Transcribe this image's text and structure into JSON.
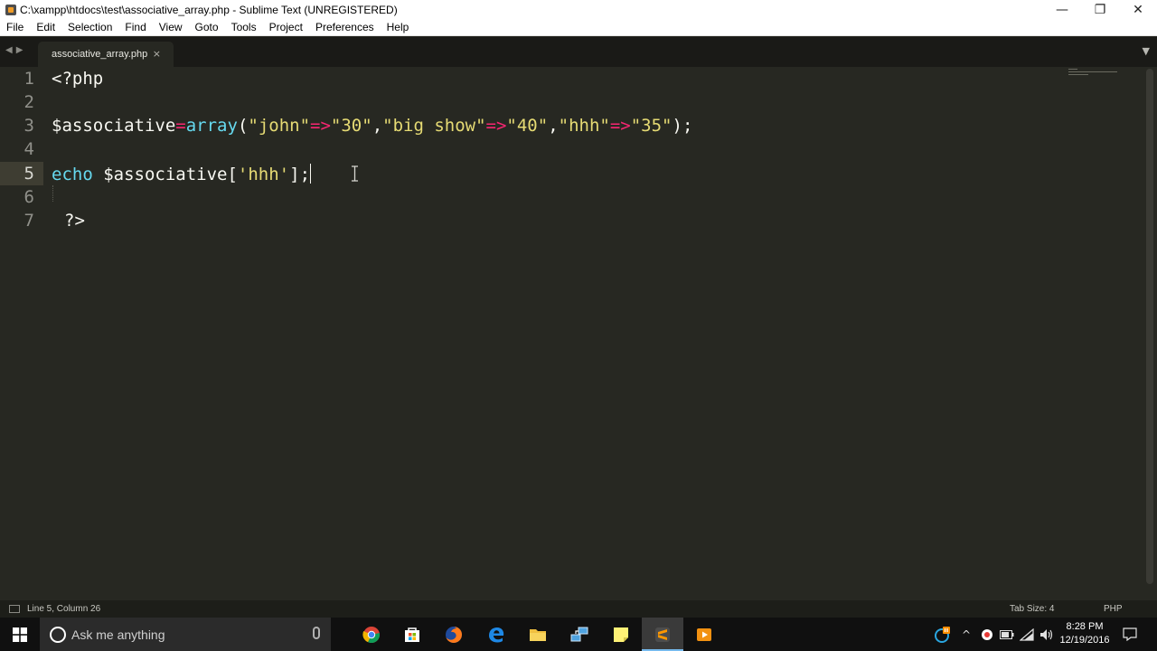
{
  "window": {
    "title": "C:\\xampp\\htdocs\\test\\associative_array.php - Sublime Text (UNREGISTERED)",
    "controls": {
      "minimize": "—",
      "restore": "❐",
      "close": "✕"
    }
  },
  "menu": [
    "File",
    "Edit",
    "Selection",
    "Find",
    "View",
    "Goto",
    "Tools",
    "Project",
    "Preferences",
    "Help"
  ],
  "tabs": {
    "nav_arrows": "◀▶",
    "active": {
      "label": "associative_array.php",
      "close": "×"
    },
    "dropdown": "▼"
  },
  "editor": {
    "line_numbers": [
      "1",
      "2",
      "3",
      "4",
      "5",
      "6",
      "7"
    ],
    "active_line": 5,
    "lines": {
      "l1": {
        "t1": "<?php"
      },
      "l3": {
        "t1": "$associative",
        "t2": "=",
        "t3": "array",
        "t4": "(",
        "t5": "\"john\"",
        "t6": "=>",
        "t7": "\"30\"",
        "t8": ",",
        "t9": "\"big show\"",
        "t10": "=>",
        "t11": "\"40\"",
        "t12": ",",
        "t13": "\"hhh\"",
        "t14": "=>",
        "t15": "\"35\"",
        "t16": ");"
      },
      "l5": {
        "t1": "echo",
        "t2": " $associative[",
        "t3": "'hhh'",
        "t4": "];"
      },
      "l7": {
        "t1": "?>"
      }
    }
  },
  "colors": {
    "background": "#272822",
    "keyword": "#66d9ef",
    "string": "#e6db74",
    "operator": "#f92672",
    "text": "#f8f8f2"
  },
  "status": {
    "position": "Line 5, Column 26",
    "tab_size": "Tab Size: 4",
    "syntax": "PHP"
  },
  "taskbar": {
    "search_placeholder": "Ask me anything",
    "apps": [
      "chrome-icon",
      "store-icon",
      "firefox-icon",
      "edge-icon",
      "file-explorer-icon",
      "remote-desktop-icon",
      "sticky-notes-icon",
      "sublime-text-icon",
      "media-player-icon"
    ],
    "clock": {
      "time": "8:28 PM",
      "date": "12/19/2016"
    }
  }
}
